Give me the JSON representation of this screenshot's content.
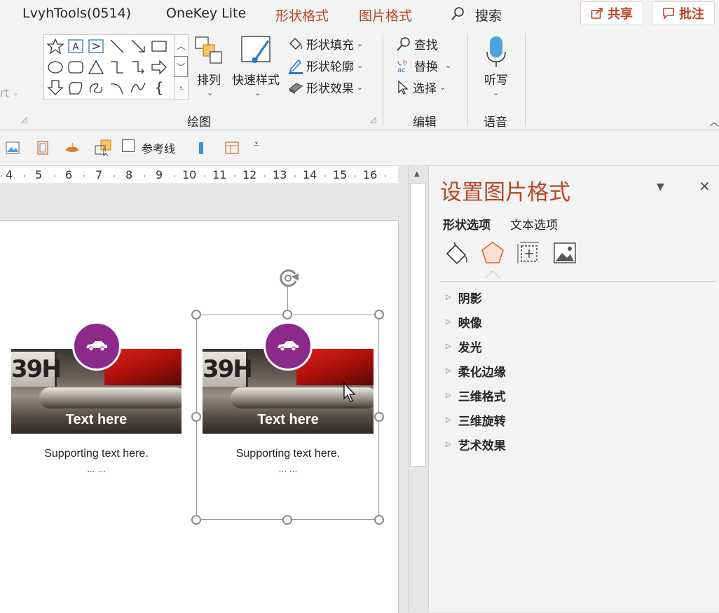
{
  "tabs": {
    "t1": "LvyhTools(0514)",
    "t2": "OneKey Lite",
    "t3": "形状格式",
    "t4": "图片格式",
    "search": "搜索",
    "share": "共享",
    "comment": "批注"
  },
  "ribbon": {
    "arrange": "排列",
    "quick_styles": "快速样式",
    "shape_fill": "形状填充",
    "shape_outline": "形状轮廓",
    "shape_effects": "形状效果",
    "find": "查找",
    "replace": "替换",
    "select": "选择",
    "dictate": "听写",
    "group_drawing": "绘图",
    "group_editing": "编辑",
    "group_voice": "语音",
    "left_cut": "rt"
  },
  "qat": {
    "guides": "参考线"
  },
  "ruler": [
    "4",
    "5",
    "6",
    "7",
    "8",
    "9",
    "10",
    "11",
    "12",
    "13",
    "14",
    "15",
    "16"
  ],
  "slide": {
    "card1": {
      "title": "Text here",
      "support": "Supporting text here.",
      "dots": "... ..."
    },
    "card2": {
      "title": "Text here",
      "support": "Supporting text here.",
      "dots": "... ..."
    },
    "plate": "39H",
    "accent": "#8b2a8b"
  },
  "pane": {
    "title": "设置图片格式",
    "tab_shape": "形状选项",
    "tab_text": "文本选项",
    "sections": [
      "阴影",
      "映像",
      "发光",
      "柔化边缘",
      "三维格式",
      "三维旋转",
      "艺术效果"
    ]
  }
}
